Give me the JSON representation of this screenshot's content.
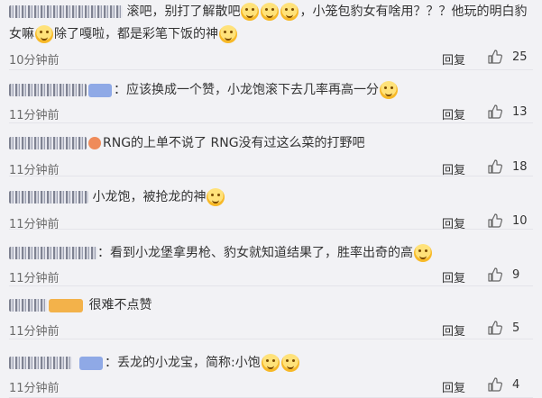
{
  "comments": [
    {
      "text_line1": "滚吧，别打了解散吧",
      "text_line1b": "，小笼包豹女有啥用？？？他玩的明白豹",
      "text_line2a": "女嘛",
      "text_line2b": "除了嘎啦，都是彩笔下饭的神",
      "time": "10分钟前",
      "reply": "回复",
      "likes": "25"
    },
    {
      "text": "：应该换成一个赞，小龙饱滚下去几率再高一分",
      "time": "11分钟前",
      "reply": "回复",
      "likes": "13"
    },
    {
      "text": "RNG的上单不说了 RNG没有过这么菜的打野吧",
      "time": "11分钟前",
      "reply": "回复",
      "likes": "18"
    },
    {
      "text": "小龙饱，被抢龙的神",
      "time": "11分钟前",
      "reply": "回复",
      "likes": "10"
    },
    {
      "text": "：看到小龙堡拿男枪、豹女就知道结果了，胜率出奇的高",
      "time": "11分钟前",
      "reply": "回复",
      "likes": "9"
    },
    {
      "text": "很难不点赞",
      "time": "11分钟前",
      "reply": "回复",
      "likes": "5"
    },
    {
      "text": "：丢龙的小龙宝，简称:小饱",
      "time": "11分钟前",
      "reply": "回复",
      "likes": "4"
    }
  ]
}
